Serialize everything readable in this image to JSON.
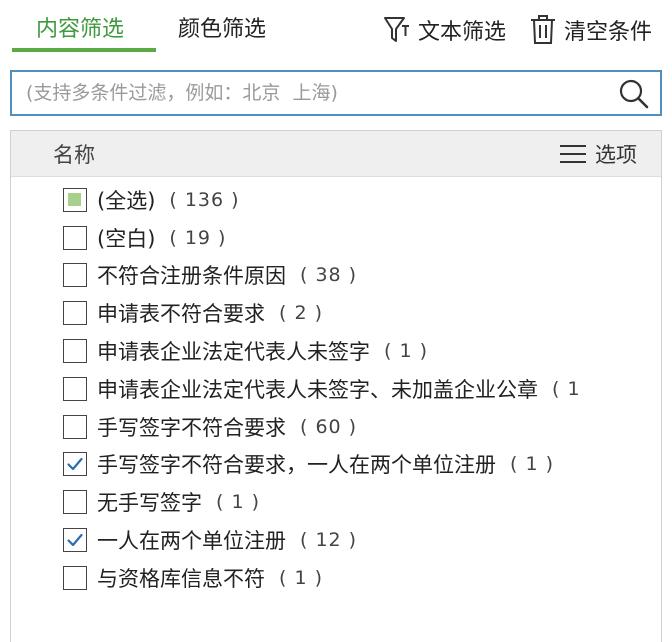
{
  "tabs": {
    "content": "内容筛选",
    "color": "颜色筛选"
  },
  "toolbar": {
    "text_filter": "文本筛选",
    "clear": "清空条件"
  },
  "search": {
    "placeholder": "(支持多条件过滤，例如：北京  上海)"
  },
  "list_header": {
    "name": "名称",
    "options": "选项"
  },
  "items": [
    {
      "label": "(全选)",
      "count": "( 136 )",
      "state": "partial"
    },
    {
      "label": "(空白)",
      "count": "( 19 )",
      "state": "unchecked"
    },
    {
      "label": "不符合注册条件原因",
      "count": "( 38 )",
      "state": "unchecked"
    },
    {
      "label": "申请表不符合要求",
      "count": "( 2 )",
      "state": "unchecked"
    },
    {
      "label": "申请表企业法定代表人未签字",
      "count": "( 1 )",
      "state": "unchecked"
    },
    {
      "label": "申请表企业法定代表人未签字、未加盖企业公章",
      "count": "( 1",
      "state": "unchecked"
    },
    {
      "label": "手写签字不符合要求",
      "count": "( 60 )",
      "state": "unchecked"
    },
    {
      "label": "手写签字不符合要求，一人在两个单位注册",
      "count": "( 1 )",
      "state": "checked"
    },
    {
      "label": "无手写签字",
      "count": "( 1 )",
      "state": "unchecked"
    },
    {
      "label": "一人在两个单位注册",
      "count": "( 12 )",
      "state": "checked"
    },
    {
      "label": "与资格库信息不符",
      "count": "( 1 )",
      "state": "unchecked"
    }
  ],
  "colors": {
    "accent_green": "#5aaa46",
    "active_tab_text": "#3f9a3f",
    "search_border": "#4f8fbf",
    "partial_fill": "#a8d08d",
    "check_color": "#2b6cb0"
  }
}
